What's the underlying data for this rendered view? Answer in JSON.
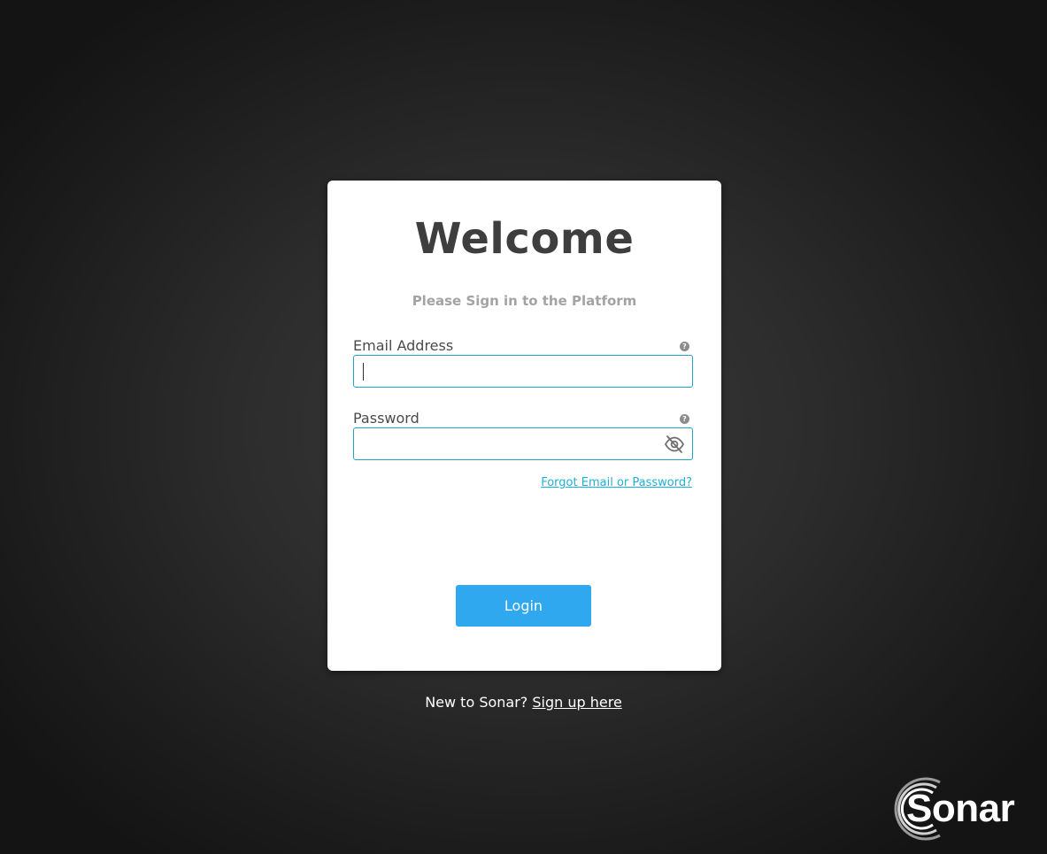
{
  "card": {
    "title": "Welcome",
    "subtitle": "Please Sign in to the Platform"
  },
  "email": {
    "label": "Email Address",
    "value": "",
    "help_icon": "question-circle-icon"
  },
  "password": {
    "label": "Password",
    "value": "",
    "help_icon": "question-circle-icon",
    "visibility_icon": "eye-slash-icon"
  },
  "forgot_link": "Forgot Email or Password?",
  "login_button": "Login",
  "signup": {
    "prompt": "New to Sonar?",
    "link": "Sign up here"
  },
  "brand": {
    "name": "Sonar",
    "logo_icon": "sonar-rings-logo"
  },
  "colors": {
    "accent": "#2fa8f0",
    "input_border": "#1fa3c7",
    "link": "#1fb0d6",
    "title": "#3e3e3e",
    "subtitle": "#a3a3a3"
  }
}
